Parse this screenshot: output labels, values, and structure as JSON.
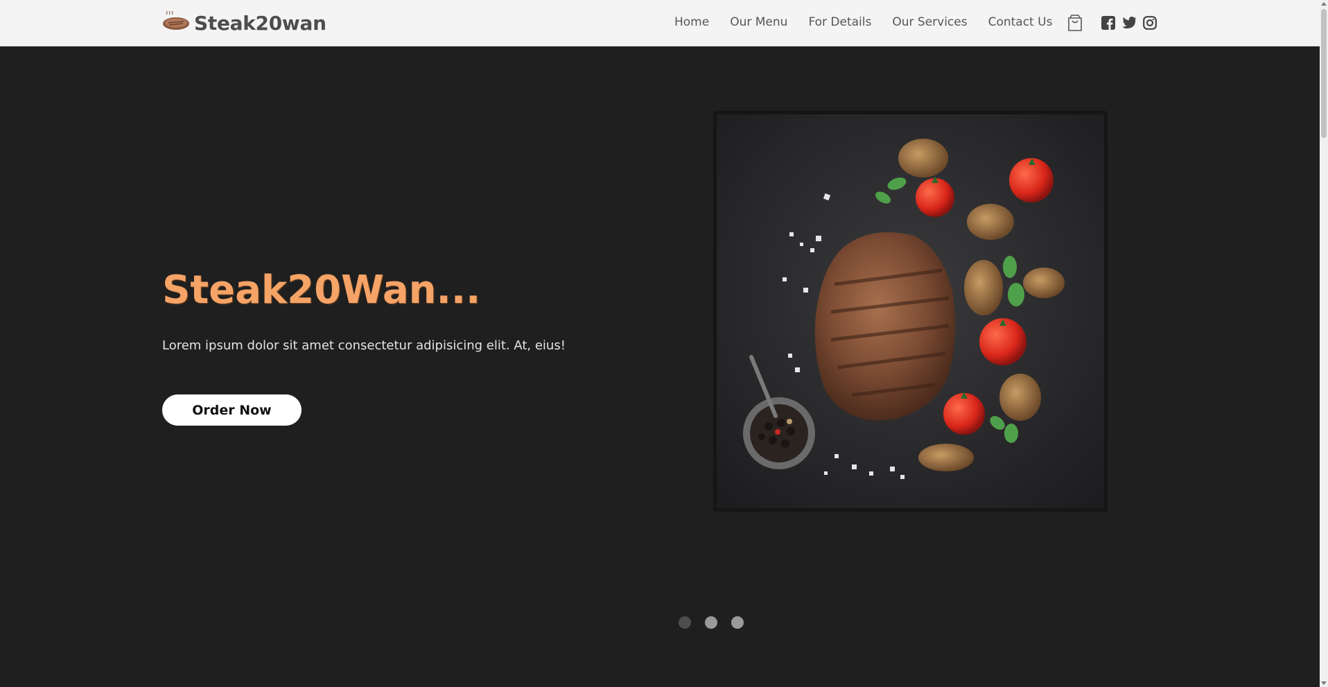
{
  "brand": {
    "name": "Steak20wan",
    "icon": "steak-logo-icon"
  },
  "nav": {
    "links": [
      {
        "label": "Home"
      },
      {
        "label": "Our Menu"
      },
      {
        "label": "For Details"
      },
      {
        "label": "Our Services"
      },
      {
        "label": "Contact Us"
      }
    ],
    "icons": [
      "shopping-bag-icon",
      "facebook-icon",
      "twitter-icon",
      "instagram-icon"
    ]
  },
  "hero": {
    "title": "Steak20Wan...",
    "text": "Lorem ipsum dolor sit amet consectetur adipisicing elit. At, eius!",
    "button_label": "Order Now",
    "image": "grilled-steak-on-slate-photo"
  },
  "carousel": {
    "slides": 3,
    "active_index": 0
  },
  "colors": {
    "background": "#1f1f1f",
    "navbar": "#f4f4f4",
    "title_accent": "#f5a366",
    "button": "#ffffff"
  }
}
